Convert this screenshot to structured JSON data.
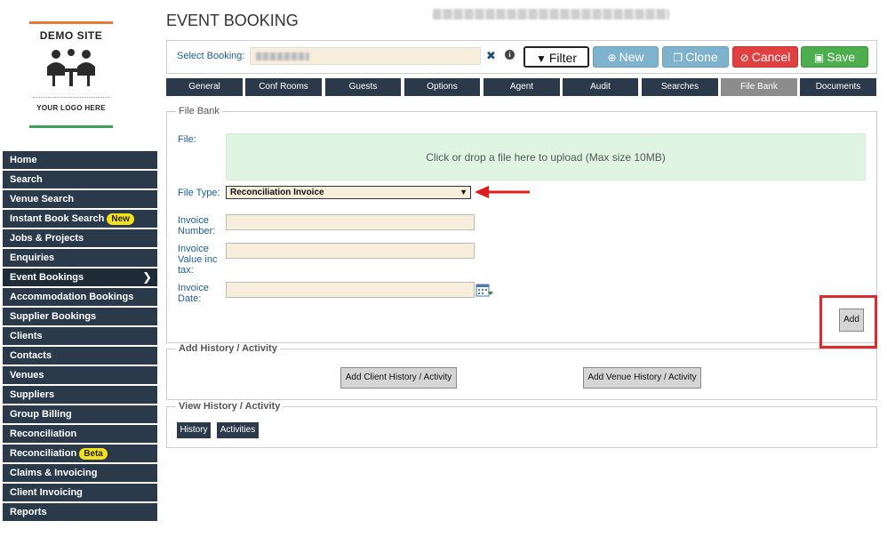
{
  "logo": {
    "title": "DEMO SITE",
    "subtitle": "YOUR LOGO HERE"
  },
  "sidebar": {
    "items": [
      {
        "label": "Home"
      },
      {
        "label": "Search"
      },
      {
        "label": "Venue Search"
      },
      {
        "label": "Instant Book Search",
        "badge": "New"
      },
      {
        "label": "Jobs & Projects"
      },
      {
        "label": "Enquiries"
      },
      {
        "label": "Event Bookings",
        "active": true
      },
      {
        "label": "Accommodation Bookings"
      },
      {
        "label": "Supplier Bookings"
      },
      {
        "label": "Clients"
      },
      {
        "label": "Contacts"
      },
      {
        "label": "Venues"
      },
      {
        "label": "Suppliers"
      },
      {
        "label": "Group Billing"
      },
      {
        "label": "Reconciliation"
      },
      {
        "label": "Reconciliation",
        "badge": "Beta"
      },
      {
        "label": "Claims & Invoicing"
      },
      {
        "label": "Client Invoicing"
      },
      {
        "label": "Reports"
      }
    ]
  },
  "header": {
    "title": "EVENT BOOKING"
  },
  "booking_bar": {
    "label": "Select Booking:",
    "filter": "Filter",
    "new": "New",
    "clone": "Clone",
    "cancel": "Cancel",
    "save": "Save"
  },
  "tabs": [
    {
      "label": "General"
    },
    {
      "label": "Conf Rooms"
    },
    {
      "label": "Guests"
    },
    {
      "label": "Options"
    },
    {
      "label": "Agent"
    },
    {
      "label": "Audit"
    },
    {
      "label": "Searches"
    },
    {
      "label": "File Bank",
      "active": true
    },
    {
      "label": "Documents"
    }
  ],
  "file_bank": {
    "legend": "File Bank",
    "file_label": "File:",
    "dropzone_text": "Click or drop a file here to upload (Max size 10MB)",
    "file_type_label": "File Type:",
    "file_type_value": "Reconciliation Invoice",
    "invoice_number_label": "Invoice Number:",
    "invoice_value_label": "Invoice Value inc tax:",
    "invoice_date_label": "Invoice Date:",
    "add_button": "Add"
  },
  "history": {
    "legend": "Add History / Activity",
    "add_client": "Add Client History / Activity",
    "add_venue": "Add Venue History / Activity"
  },
  "view_history": {
    "legend": "View History / Activity",
    "history": "History",
    "activities": "Activities"
  }
}
